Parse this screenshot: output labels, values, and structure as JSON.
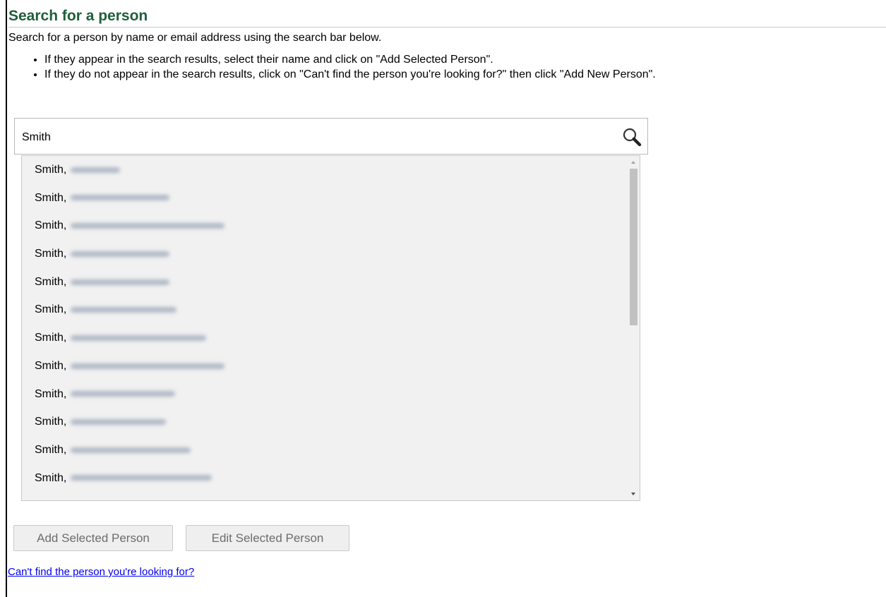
{
  "header": {
    "title": "Search for a person"
  },
  "intro_text": "Search for a person by name or email address using the search bar below.",
  "instructions": [
    "If they appear in the search results, select their name and click on \"Add Selected Person\".",
    "If they do not appear in the search results, click on \"Can't find the person you're looking for?\" then click \"Add New Person\"."
  ],
  "search": {
    "value": "Smith",
    "icon": "search-icon"
  },
  "results": [
    {
      "name": "Smith,"
    },
    {
      "name": "Smith,"
    },
    {
      "name": "Smith,"
    },
    {
      "name": "Smith,"
    },
    {
      "name": "Smith,"
    },
    {
      "name": "Smith,"
    },
    {
      "name": "Smith,"
    },
    {
      "name": "Smith,"
    },
    {
      "name": "Smith,"
    },
    {
      "name": "Smith,"
    },
    {
      "name": "Smith,"
    },
    {
      "name": "Smith,"
    }
  ],
  "buttons": {
    "add_label": "Add Selected Person",
    "edit_label": "Edit Selected Person"
  },
  "link": {
    "text": "Can't find the person you're looking for?"
  },
  "colors": {
    "title": "#1f5e3a",
    "link": "#0000ee"
  }
}
